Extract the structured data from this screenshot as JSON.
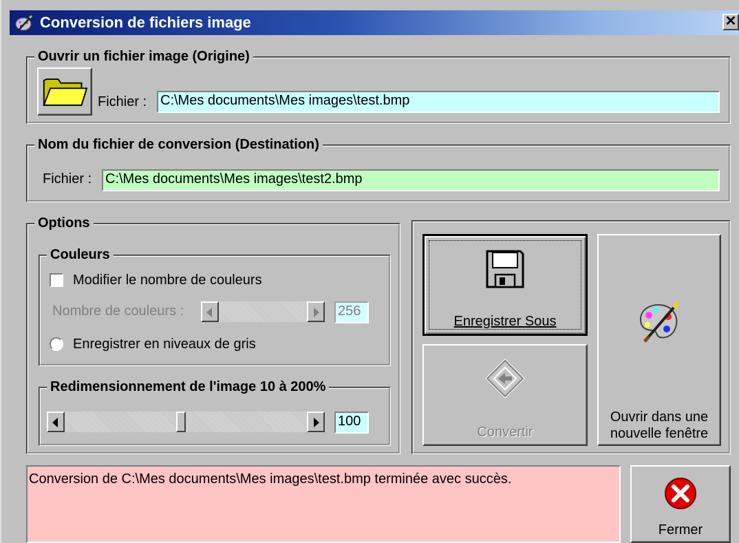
{
  "window": {
    "title": "Conversion de fichiers image",
    "close_label": "✕"
  },
  "source": {
    "legend": "Ouvrir un fichier image (Origine)",
    "file_label": "Fichier :",
    "file_value": "C:\\Mes documents\\Mes images\\test.bmp",
    "field_color": "#c8ffff"
  },
  "destination": {
    "legend": "Nom du fichier de conversion (Destination)",
    "file_label": "Fichier :",
    "file_value": "C:\\Mes documents\\Mes images\\test2.bmp",
    "field_color": "#c0ffc0"
  },
  "options": {
    "legend": "Options",
    "colors": {
      "legend": "Couleurs",
      "modify_label": "Modifier le nombre de couleurs",
      "modify_checked": false,
      "count_label": "Nombre de couleurs :",
      "count_value": "256",
      "grayscale_label": "Enregistrer en niveaux de gris",
      "grayscale_selected": false
    },
    "resize": {
      "legend": "Redimensionnement de l'image 10 à 200%",
      "value": "100",
      "min": 10,
      "max": 200
    }
  },
  "actions": {
    "save_as_label": "Enregistrer Sous",
    "convert_label": "Convertir",
    "open_new_label_line1": "Ouvrir dans une",
    "open_new_label_line2": "nouvelle fenêtre"
  },
  "status": {
    "message": "Conversion de C:\\Mes documents\\Mes images\\test.bmp terminée avec succès.",
    "background": "#ffc4c4"
  },
  "close_button": {
    "label": "Fermer"
  }
}
